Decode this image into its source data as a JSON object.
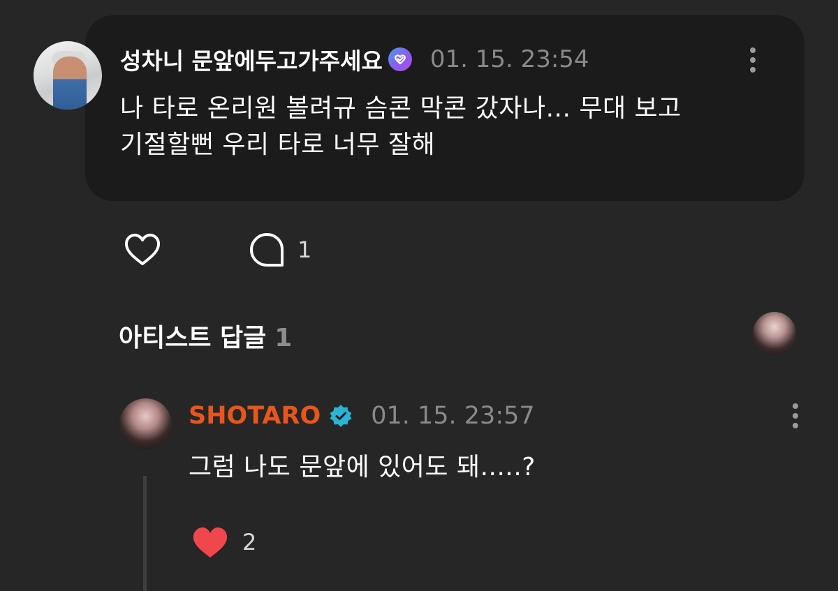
{
  "post": {
    "author": "성차니 문앞에두고가주세요",
    "timestamp": "01. 15. 23:54",
    "body_line1": "나 타로 온리원 볼려규 슴콘 막콘 갔자나... 무대 보고",
    "body_line2": "기절할뻔 우리 타로 너무 잘해",
    "comment_count": "1"
  },
  "artist_replies": {
    "title": "아티스트 답글",
    "count": "1"
  },
  "reply": {
    "author": "SHOTARO",
    "timestamp": "01. 15. 23:57",
    "body": "그럼 나도 문앞에 있어도 돼.....?",
    "like_count": "2"
  },
  "colors": {
    "background": "#262627",
    "card": "#1b1b1c",
    "artist_name": "#e8561b",
    "liked_heart": "#f0474d",
    "verified_blue": "#2bb3d3"
  },
  "icons": [
    "more-vertical-icon",
    "verified-badge-icon",
    "heart-outline-icon",
    "comment-bubble-icon",
    "heart-filled-icon"
  ]
}
